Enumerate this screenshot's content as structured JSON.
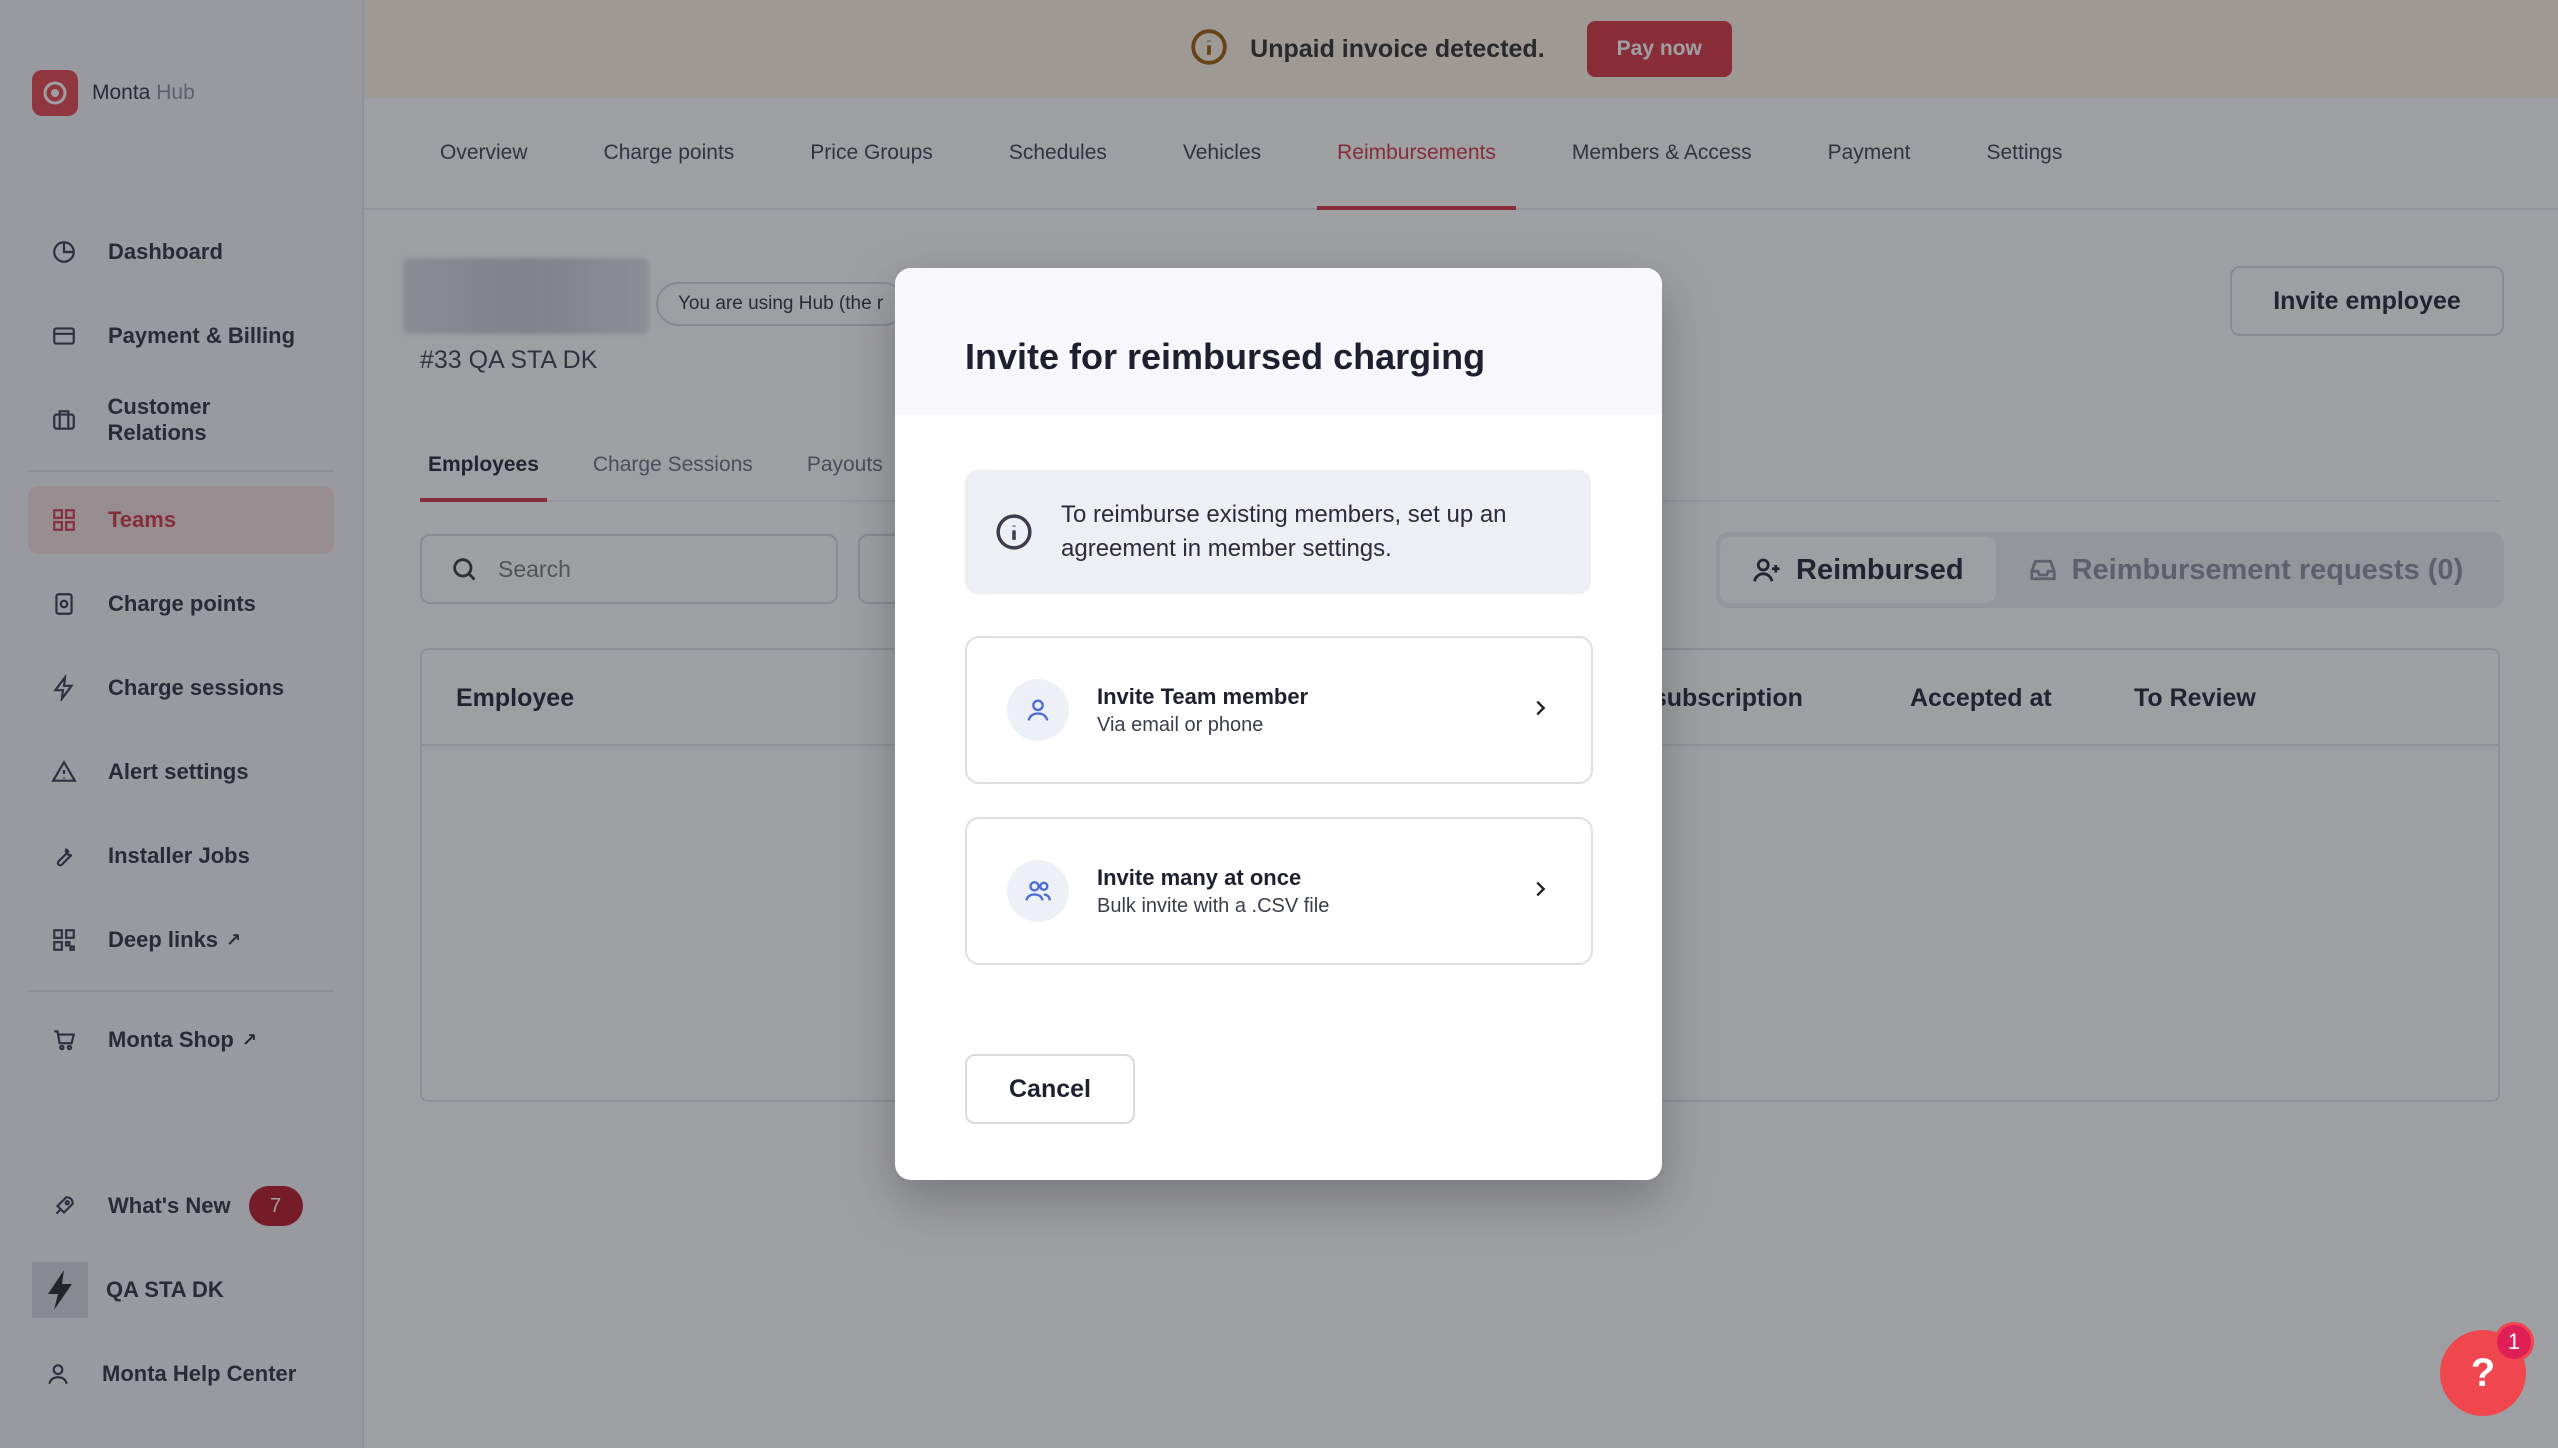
{
  "brand": {
    "name": "Monta",
    "suffix": "Hub"
  },
  "sidebar": {
    "items": [
      {
        "label": "Dashboard",
        "icon": "dashboard-icon"
      },
      {
        "label": "Payment & Billing",
        "icon": "credit-card-icon"
      },
      {
        "label": "Customer Relations",
        "icon": "briefcase-icon"
      },
      {
        "label": "Teams",
        "icon": "grid-icon",
        "active": true
      },
      {
        "label": "Charge points",
        "icon": "charge-point-icon"
      },
      {
        "label": "Charge sessions",
        "icon": "lightning-icon"
      },
      {
        "label": "Alert settings",
        "icon": "alert-icon"
      },
      {
        "label": "Installer Jobs",
        "icon": "wrench-icon"
      },
      {
        "label": "Deep links",
        "icon": "qr-icon",
        "external": true
      }
    ],
    "shop": {
      "label": "Monta Shop",
      "external": true
    },
    "whats_new": {
      "label": "What's New",
      "count": "7"
    },
    "org": {
      "label": "QA STA DK"
    },
    "help_center": {
      "label": "Monta Help Center"
    },
    "external_glyph": "↗"
  },
  "banner": {
    "text": "Unpaid invoice detected.",
    "button": "Pay now"
  },
  "tabs": [
    "Overview",
    "Charge points",
    "Price Groups",
    "Schedules",
    "Vehicles",
    "Reimbursements",
    "Members & Access",
    "Payment",
    "Settings"
  ],
  "team": {
    "using_hub": "You are using Hub (the r",
    "id": "#33 QA STA DK",
    "invite_button": "Invite employee"
  },
  "subtabs": [
    "Employees",
    "Charge Sessions",
    "Payouts"
  ],
  "search": {
    "placeholder": "Search"
  },
  "segments": {
    "reimbursed": "Reimbursed",
    "requests": "Reimbursement requests (0)"
  },
  "table": {
    "headers": {
      "employee": "Employee",
      "subscription": "y subscription",
      "accepted": "Accepted at",
      "review": "To Review"
    }
  },
  "modal": {
    "title": "Invite for reimbursed charging",
    "info": "To reimburse existing members, set up an agreement in member settings.",
    "options": [
      {
        "title": "Invite Team member",
        "subtitle": "Via email or phone"
      },
      {
        "title": "Invite many at once",
        "subtitle": "Bulk invite with a .CSV file"
      }
    ],
    "cancel": "Cancel"
  },
  "help": {
    "glyph": "?",
    "badge": "1"
  },
  "colors": {
    "accent": "#d2323f",
    "banner_bg": "#fff4e3",
    "pay_button": "#d9323f"
  }
}
